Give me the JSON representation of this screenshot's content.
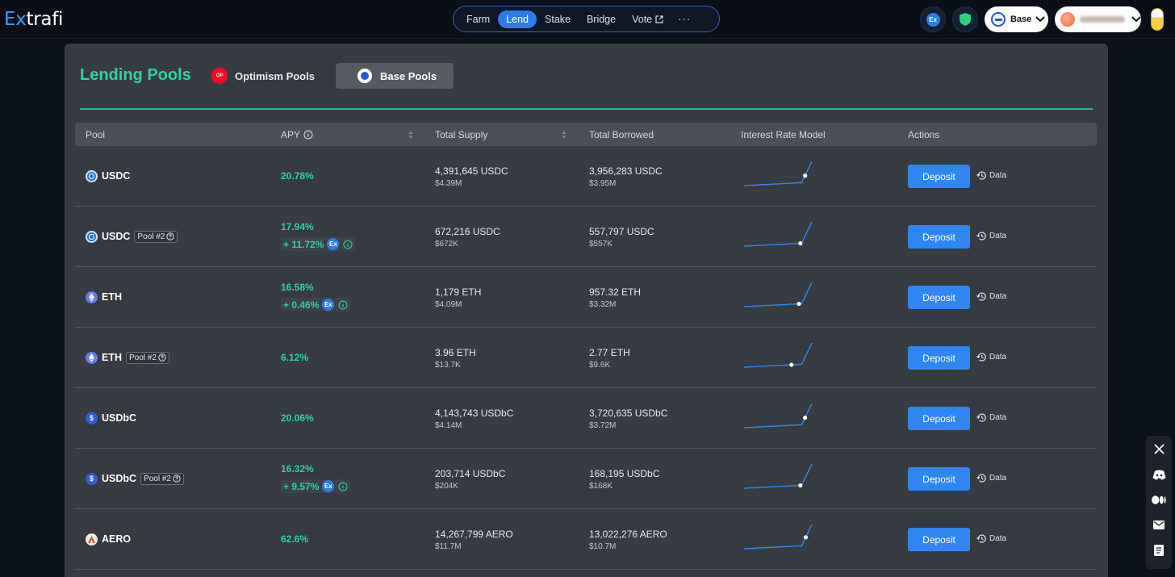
{
  "header": {
    "logo_prefix": "Ex",
    "logo_suffix": "trafi",
    "nav": [
      {
        "label": "Farm",
        "active": false
      },
      {
        "label": "Lend",
        "active": true
      },
      {
        "label": "Stake",
        "active": false
      },
      {
        "label": "Bridge",
        "active": false
      },
      {
        "label": "Vote",
        "active": false,
        "external": true
      }
    ],
    "more_label": "···",
    "ex_token_label": "Ex",
    "network_label": "Base"
  },
  "page": {
    "title": "Lending Pools",
    "tabs": [
      {
        "label": "Optimism Pools",
        "badge": "OP",
        "active": false
      },
      {
        "label": "Base Pools",
        "active": true
      }
    ]
  },
  "table": {
    "columns": [
      "Pool",
      "APY",
      "Total Supply",
      "Total Borrowed",
      "Interest Rate Model",
      "Actions"
    ],
    "deposit_label": "Deposit",
    "data_label": "Data",
    "rows": [
      {
        "token": "USDC",
        "icon": "usdc-icon",
        "tag": "",
        "apy": "20.78%",
        "boost": "",
        "supply": "4,391,645 USDC",
        "supply_usd": "$4.39M",
        "borrowed": "3,956,283 USDC",
        "borrowed_usd": "$3.95M",
        "utilization": 0.9
      },
      {
        "token": "USDC",
        "icon": "usdc-icon",
        "tag": "Pool #2",
        "apy": "17.94%",
        "boost": "+ 11.72%",
        "supply": "672,216 USDC",
        "supply_usd": "$672K",
        "borrowed": "557,797 USDC",
        "borrowed_usd": "$557K",
        "utilization": 0.83
      },
      {
        "token": "ETH",
        "icon": "eth-icon",
        "tag": "",
        "apy": "16.58%",
        "boost": "+ 0.46%",
        "supply": "1,179 ETH",
        "supply_usd": "$4.09M",
        "borrowed": "957.32 ETH",
        "borrowed_usd": "$3.32M",
        "utilization": 0.81
      },
      {
        "token": "ETH",
        "icon": "eth-icon",
        "tag": "Pool #2",
        "apy": "6.12%",
        "boost": "",
        "supply": "3.96 ETH",
        "supply_usd": "$13.7K",
        "borrowed": "2.77 ETH",
        "borrowed_usd": "$9.6K",
        "utilization": 0.7
      },
      {
        "token": "USDbC",
        "icon": "usdbc-icon",
        "tag": "",
        "apy": "20.06%",
        "boost": "",
        "supply": "4,143,743 USDbC",
        "supply_usd": "$4.14M",
        "borrowed": "3,720,635 USDbC",
        "borrowed_usd": "$3.72M",
        "utilization": 0.9
      },
      {
        "token": "USDbC",
        "icon": "usdbc-icon",
        "tag": "Pool #2",
        "apy": "16.32%",
        "boost": "+ 9.57%",
        "supply": "203,714 USDbC",
        "supply_usd": "$204K",
        "borrowed": "168,195 USDbC",
        "borrowed_usd": "$168K",
        "utilization": 0.83
      },
      {
        "token": "AERO",
        "icon": "aero-icon",
        "tag": "",
        "apy": "62.6%",
        "boost": "",
        "supply": "14,267,799 AERO",
        "supply_usd": "$11.7M",
        "borrowed": "13,022,276 AERO",
        "borrowed_usd": "$10.7M",
        "utilization": 0.91
      }
    ]
  },
  "social": [
    "x-icon",
    "discord-icon",
    "medium-icon",
    "mail-icon",
    "docs-icon"
  ],
  "colors": {
    "accent_green": "#2dd4a0",
    "accent_blue": "#2f86f2",
    "panel": "#363b42"
  }
}
